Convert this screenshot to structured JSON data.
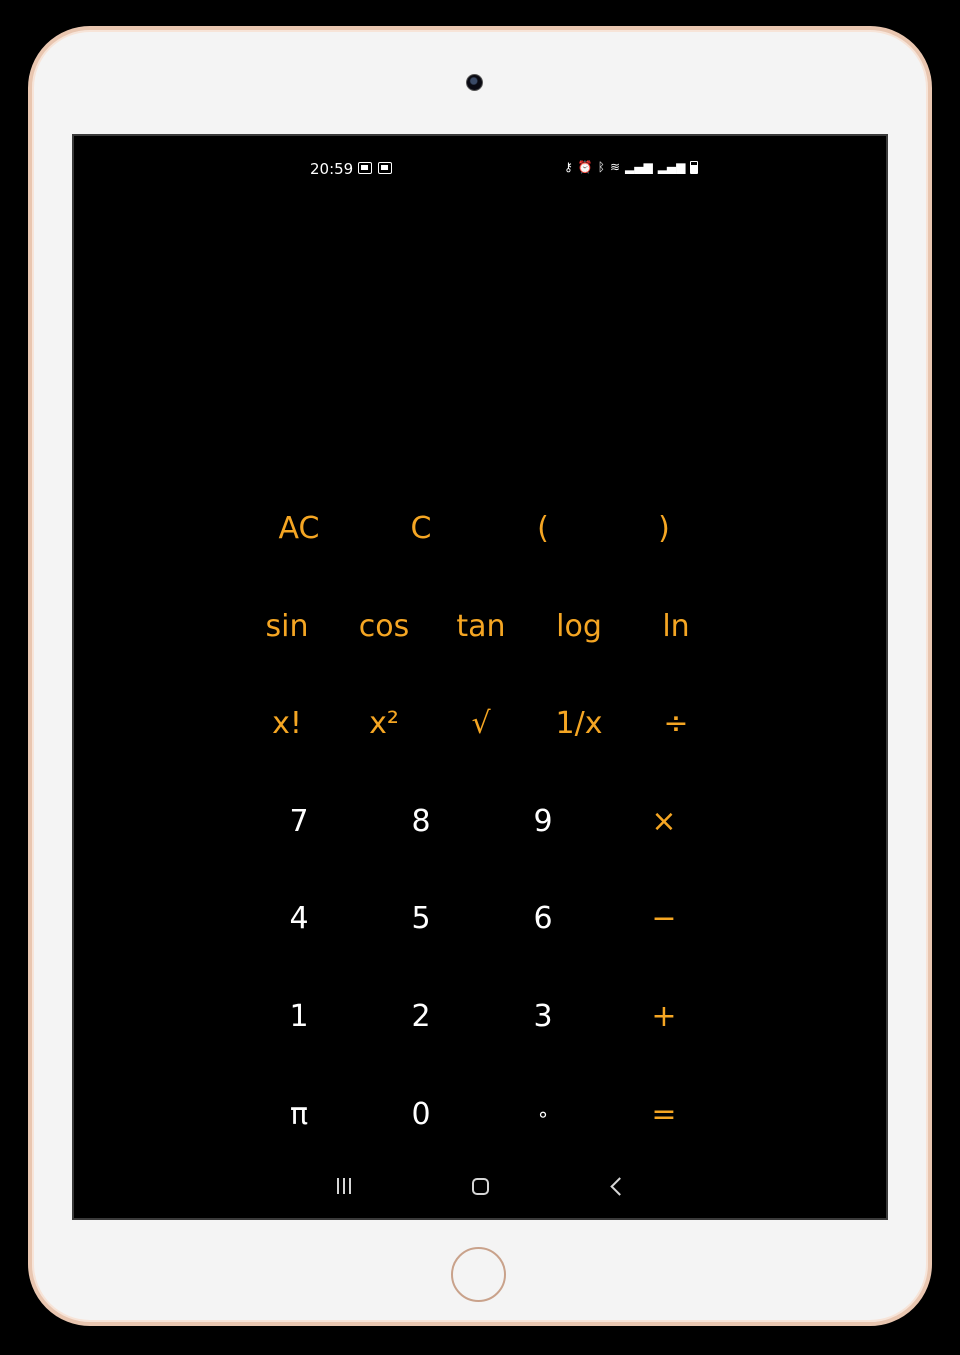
{
  "status_bar": {
    "time": "20:59",
    "left_icons": [
      "image-icon",
      "cast-icon"
    ],
    "right_icons": [
      "key-icon",
      "alarm-icon",
      "bluetooth-icon",
      "wifi-icon",
      "signal-icon",
      "signal-icon",
      "battery-icon"
    ]
  },
  "keypad": {
    "rows": [
      [
        "AC",
        "C",
        "(",
        ")"
      ],
      [
        "sin",
        "cos",
        "tan",
        "log",
        "ln"
      ],
      [
        "x!",
        "x²",
        "√",
        "1/x",
        "÷"
      ],
      [
        "7",
        "8",
        "9",
        "×"
      ],
      [
        "4",
        "5",
        "6",
        "−"
      ],
      [
        "1",
        "2",
        "3",
        "+"
      ],
      [
        "π",
        "0",
        "∘",
        "="
      ]
    ]
  },
  "nav_bar": {
    "buttons": [
      "recents-icon",
      "home-icon",
      "back-icon"
    ]
  },
  "colors": {
    "accent": "#f5a623",
    "digit": "#ffffff",
    "screen_background": "#000000",
    "device_frame": "#f4f4f4",
    "device_trim": "#e9c6b0"
  }
}
